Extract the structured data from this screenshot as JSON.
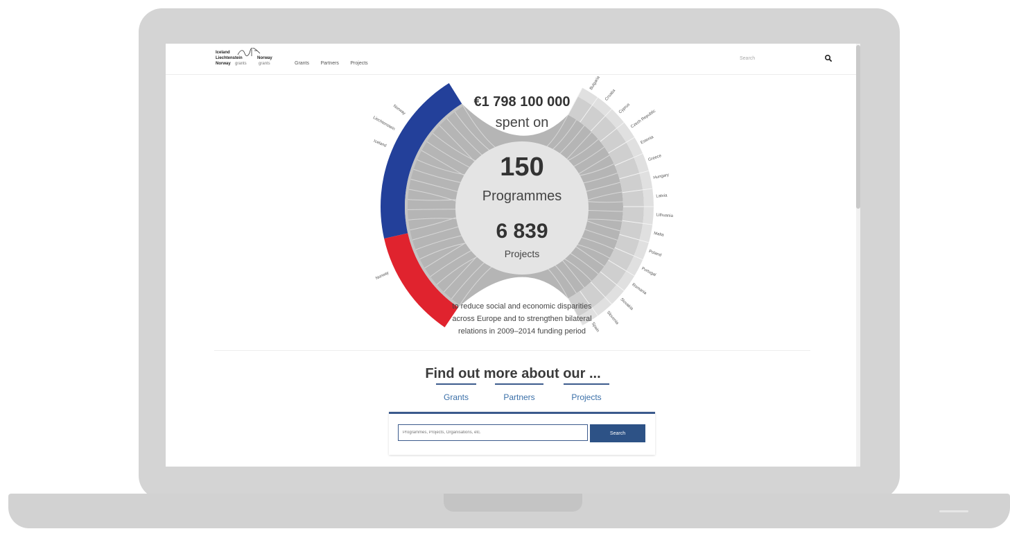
{
  "nav": {
    "logo": {
      "line1": "Iceland",
      "line2": "Liechtenstein",
      "line3": "Norway",
      "norway": "Norway",
      "grants1": "grants",
      "grants2": "grants"
    },
    "links": [
      "Grants",
      "Partners",
      "Projects"
    ],
    "search_placeholder": "Search"
  },
  "summary": {
    "amount": "€1 798 100 000",
    "spent_on": "spent on",
    "programmes_count": "150",
    "programmes_label": "Programmes",
    "projects_count": "6 839",
    "projects_label": "Projects",
    "description": [
      "to reduce social and economic disparities",
      "across Europe and to strengthen bilateral",
      "relations in 2009–2014 funding period"
    ]
  },
  "chart_data": {
    "type": "chord",
    "donor_labels": [
      "Iceland",
      "Liechtenstein",
      "Norway",
      "Norway"
    ],
    "donor_shares": [
      0.62,
      0.38
    ],
    "beneficiary_labels": [
      "Bulgaria",
      "Croatia",
      "Cyprus",
      "Czech Republic",
      "Estonia",
      "Greece",
      "Hungary",
      "Latvia",
      "Lithuania",
      "Malta",
      "Poland",
      "Portugal",
      "Romania",
      "Slovakia",
      "Slovenia",
      "Spain"
    ],
    "colors": {
      "donor_blue": "#23409a",
      "donor_red": "#e0232e",
      "flow_grey": "#b5b5b5",
      "arc_grey": "#cfcfcf",
      "center_grey": "#e4e4e4"
    }
  },
  "find_more": {
    "title": "Find out more about our ...",
    "tabs": [
      "Grants",
      "Partners",
      "Projects"
    ]
  },
  "search": {
    "placeholder": "Programmes, Projects, Organisations, etc.",
    "button_label": "Search"
  },
  "colors": {
    "accent": "#2d5286",
    "link": "#3a6fa8"
  }
}
